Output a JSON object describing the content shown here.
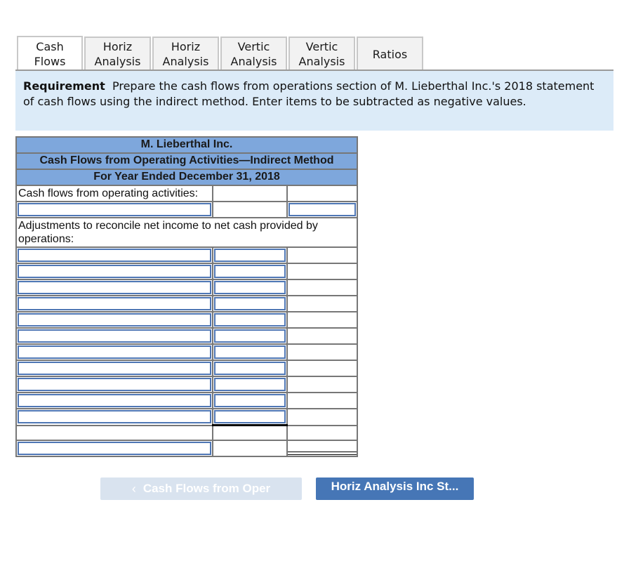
{
  "tabs": [
    {
      "line1": "Cash",
      "line2": "Flows",
      "active": true
    },
    {
      "line1": "Horiz",
      "line2": "Analysis",
      "active": false
    },
    {
      "line1": "Horiz",
      "line2": "Analysis",
      "active": false
    },
    {
      "line1": "Vertic",
      "line2": "Analysis",
      "active": false
    },
    {
      "line1": "Vertic",
      "line2": "Analysis",
      "active": false
    },
    {
      "line1": "Ratios",
      "line2": "",
      "active": false
    }
  ],
  "requirement": {
    "label": "Requirement",
    "text": "Prepare the cash flows from operations section of M. Lieberthal Inc.'s 2018 statement of cash flows using the indirect method.  Enter items to be subtracted as negative values."
  },
  "statement": {
    "company": "M. Lieberthal Inc.",
    "title": "Cash Flows from Operating Activities—Indirect Method",
    "period": "For Year Ended December 31, 2018",
    "section_operating": "Cash flows from operating activities:",
    "section_adjustments": "Adjustments to reconcile net income to net cash provided by operations:",
    "net_income_row": {
      "label_value": "",
      "amount_value": ""
    },
    "adjustment_rows": [
      {
        "label": "",
        "amount": ""
      },
      {
        "label": "",
        "amount": ""
      },
      {
        "label": "",
        "amount": ""
      },
      {
        "label": "",
        "amount": ""
      },
      {
        "label": "",
        "amount": ""
      },
      {
        "label": "",
        "amount": ""
      },
      {
        "label": "",
        "amount": ""
      },
      {
        "label": "",
        "amount": ""
      },
      {
        "label": "",
        "amount": ""
      },
      {
        "label": "",
        "amount": ""
      },
      {
        "label": "",
        "amount": ""
      }
    ],
    "net_cash_row": {
      "label": ""
    }
  },
  "nav": {
    "prev_label": "Cash Flows from Oper",
    "prev_icon": "chevron-left-icon",
    "next_label": "Horiz Analysis Inc St..."
  },
  "colors": {
    "header_blue": "#7ea7dc",
    "requirement_bg": "#dcebf8",
    "input_border": "#4f77b5",
    "next_button": "#4676b6",
    "prev_button_disabled": "#d9e3ef"
  }
}
